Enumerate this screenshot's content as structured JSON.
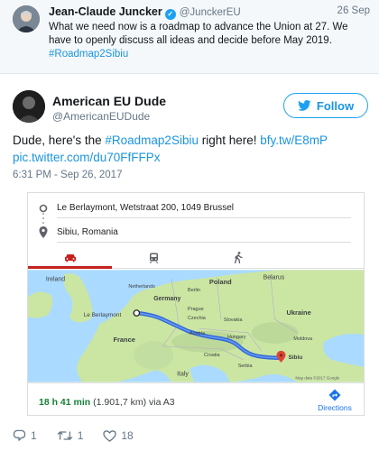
{
  "quoted": {
    "name": "Jean-Claude Juncker",
    "handle": "@JunckerEU",
    "date": "26 Sep",
    "text": "What we need now is a roadmap to advance the Union at 27. We have to openly discuss all ideas and decide before May 2019.",
    "hashtag": "#Roadmap2Sibiu"
  },
  "tweet": {
    "name": "American EU Dude",
    "handle": "@AmericanEUDude",
    "follow_label": "Follow",
    "text_prefix": "Dude, here's the ",
    "hashtag": "#Roadmap2Sibiu",
    "text_mid": " right here! ",
    "link1": "bfy.tw/E8mP",
    "link2": "pic.twitter.com/du70FfFFPx",
    "timestamp": "6:31 PM - Sep 26, 2017"
  },
  "map_card": {
    "origin": "Le Berlaymont, Wetstraat 200, 1049 Brussel",
    "destination": "Sibiu, Romania",
    "duration": "18 h 41 min",
    "distance": "(1.901,7 km) via A3",
    "directions_label": "Directions",
    "map_data_label": "Map data ©2017 Google",
    "labels": {
      "ireland": "Ireland",
      "netherlands": "Netherlands",
      "berlin": "Berlin",
      "germany": "Germany",
      "poland": "Poland",
      "belarus": "Belarus",
      "le_berlaymont": "Le Berlaymont",
      "prague": "Prague",
      "czechia": "Czechia",
      "slovakia": "Slovakia",
      "ukraine": "Ukraine",
      "france": "France",
      "austria": "Austria",
      "hungary": "Hungary",
      "moldova": "Moldova",
      "sibiu": "Sibiu",
      "croatia": "Croatia",
      "serbia": "Serbia",
      "italy": "Italy"
    }
  },
  "actions": {
    "replies": "1",
    "retweets": "1",
    "likes": "18"
  },
  "colors": {
    "twitter_blue": "#1da1f2",
    "link_blue": "#1b95e0",
    "route_blue": "#3367d6",
    "drive_red": "#c5221f",
    "duration_green": "#188038"
  }
}
